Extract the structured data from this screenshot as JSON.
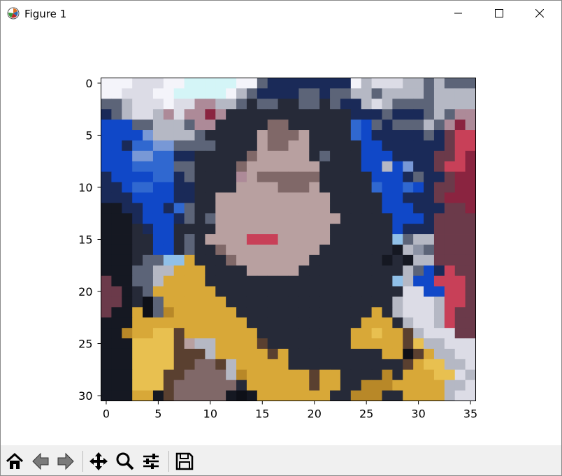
{
  "window": {
    "title": "Figure 1",
    "controls": [
      "minimize-icon",
      "maximize-icon",
      "close-icon"
    ]
  },
  "image_plot": {
    "xticks": [
      "0",
      "5",
      "10",
      "15",
      "20",
      "25",
      "30",
      "35"
    ],
    "yticks": [
      "0",
      "5",
      "10",
      "15",
      "20",
      "25",
      "30"
    ],
    "cols": 36,
    "rows": 31,
    "palette": {
      "W": "#f4f4fa",
      "w": "#dcdce6",
      "c": "#d4f5f7",
      "g": "#b5b8c4",
      "G": "#8c93a5",
      "s": "#5c6478",
      "d": "#262a38",
      "D": "#151822",
      "K": "#0e1018",
      "B": "#1048c8",
      "b": "#3068d0",
      "L": "#7898d6",
      "n": "#1a2a58",
      "p": "#ad8a98",
      "m": "#6b3a4a",
      "r": "#c84058",
      "R": "#8a2440",
      "f": "#b8a0a0",
      "F": "#a08888",
      "h": "#806868",
      "y": "#d8a838",
      "Y": "#e8c050",
      "o": "#b88828",
      "k": "#5a4030",
      "l": "#90c0e8"
    },
    "pixels": [
      "WWWwwwWWcccccWWsnnnnnnnnWgwwwggsgsss",
      "WWwwwWWcccccWgsnnnnssnssggsggggsgggg",
      "ssgwwwWwwppggsdssddssdsnngwgssssgggg",
      "nsgwwgpwppRpddddddddddddnnnsnnnsgspp",
      "BBBssgggsppdddddhhddddddbBsnsssgspRp",
      "BBBBLggggsdddddfhhhfddddbBnnnnnsnmrr",
      "BBnbbLLssssddddfhhffdddddBBnnnnnnmrr",
      "BBBLLbbnndddddhfffffdsdddBBBnnnnmmrR",
      "BBBbbbbssddddhfffffffddddBBgBLnnmrrR",
      "nBBBBbbnsddddpfhhhhhhdddddBBBnsnnmRR",
      "nnBbbBBnnddddffffhhhfdddddbBBbBnmmRR",
      "nnnBBBBnnddfffffffffffdddddBBnnnmRRR",
      "DDnnBBnbsddfffffffffffdddddBBBnnnmmR",
      "DDDnBBBnsdsffffffffffffdddddBBBnmmmm",
      "DDDdnBBddddfffffffffffddddddBnnnmmmm",
      "DDDddBBdsdffffrrrfffffddddddlsggmmmm",
      "DDDddBBdsddhfffffffffdddddddDgGsmmmm",
      "DDDdssllydddhfffffffdddddddDdDggmmmm",
      "DDDssggyyyddddfffffddddddddddgsBnrmm",
      "mDDssgyyyyddddddddddddddddddlgBBrrrm",
      "mmDdsyyyyyyddddddddddddddddddwwBBrrm",
      "mmDdKsyyyyyyddddddddddddddddgwwwgrrm",
      "mDDyKsoyyyyyydddddddddddddydgwwwgrmm",
      "DDDyyyyyyyyyyydddddddddddyyydgwwgrmm",
      "DDoyyYYkyyyyyyydddddddddyyYyykgwwwmm",
      "DDDYYYYkfggyyyykddddddddyyyyykYggwww",
      "DDDYYYYkkkgyyyyykydddddddddyyKkyggww",
      "DDDYYYYkkhhkgyyyyydddddddddddkyYYggw",
      "DDDYYYkkhhhhgoyyyyyykyyddddodyyyYYwg",
      "DDDYYYkhhhhhhdyyyyyykyyddoooyyyyyggw",
      "DDDyyDkhhhhhDKDyyyyyyyddoooddyyyygww"
    ]
  },
  "toolbar": {
    "buttons": [
      "home-icon",
      "back-icon",
      "forward-icon",
      "pan-icon",
      "zoom-icon",
      "configure-subplots-icon",
      "save-icon"
    ]
  }
}
